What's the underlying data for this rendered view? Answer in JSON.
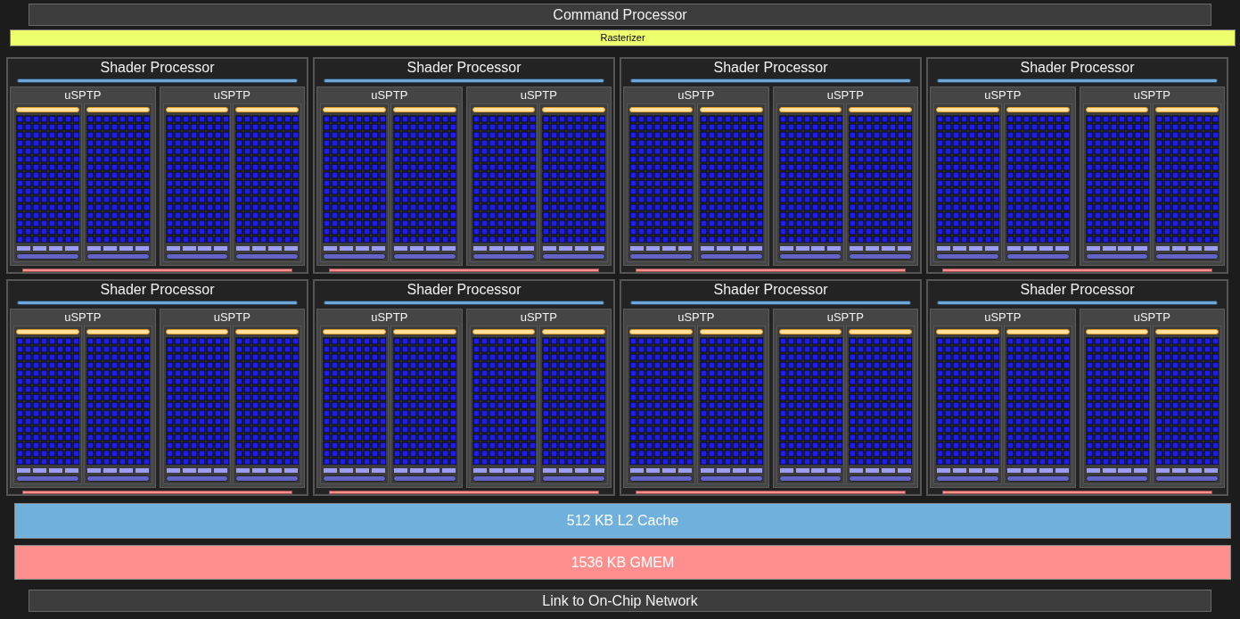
{
  "command_processor": {
    "label": "Command Processor"
  },
  "rasterizer": {
    "label": "Rasterizer"
  },
  "shader_processors": [
    {
      "title": "Shader Processor",
      "units": [
        {
          "title": "uSPTP"
        },
        {
          "title": "uSPTP"
        }
      ]
    },
    {
      "title": "Shader Processor",
      "units": [
        {
          "title": "uSPTP"
        },
        {
          "title": "uSPTP"
        }
      ]
    },
    {
      "title": "Shader Processor",
      "units": [
        {
          "title": "uSPTP"
        },
        {
          "title": "uSPTP"
        }
      ]
    },
    {
      "title": "Shader Processor",
      "units": [
        {
          "title": "uSPTP"
        },
        {
          "title": "uSPTP"
        }
      ]
    },
    {
      "title": "Shader Processor",
      "units": [
        {
          "title": "uSPTP"
        },
        {
          "title": "uSPTP"
        }
      ]
    },
    {
      "title": "Shader Processor",
      "units": [
        {
          "title": "uSPTP"
        },
        {
          "title": "uSPTP"
        }
      ]
    },
    {
      "title": "Shader Processor",
      "units": [
        {
          "title": "uSPTP"
        },
        {
          "title": "uSPTP"
        }
      ]
    },
    {
      "title": "Shader Processor",
      "units": [
        {
          "title": "uSPTP"
        },
        {
          "title": "uSPTP"
        }
      ]
    }
  ],
  "l2_cache": {
    "label": "512 KB L2 Cache"
  },
  "gmem": {
    "label": "1536 KB GMEM"
  },
  "link": {
    "label": "Link to On-Chip Network"
  }
}
